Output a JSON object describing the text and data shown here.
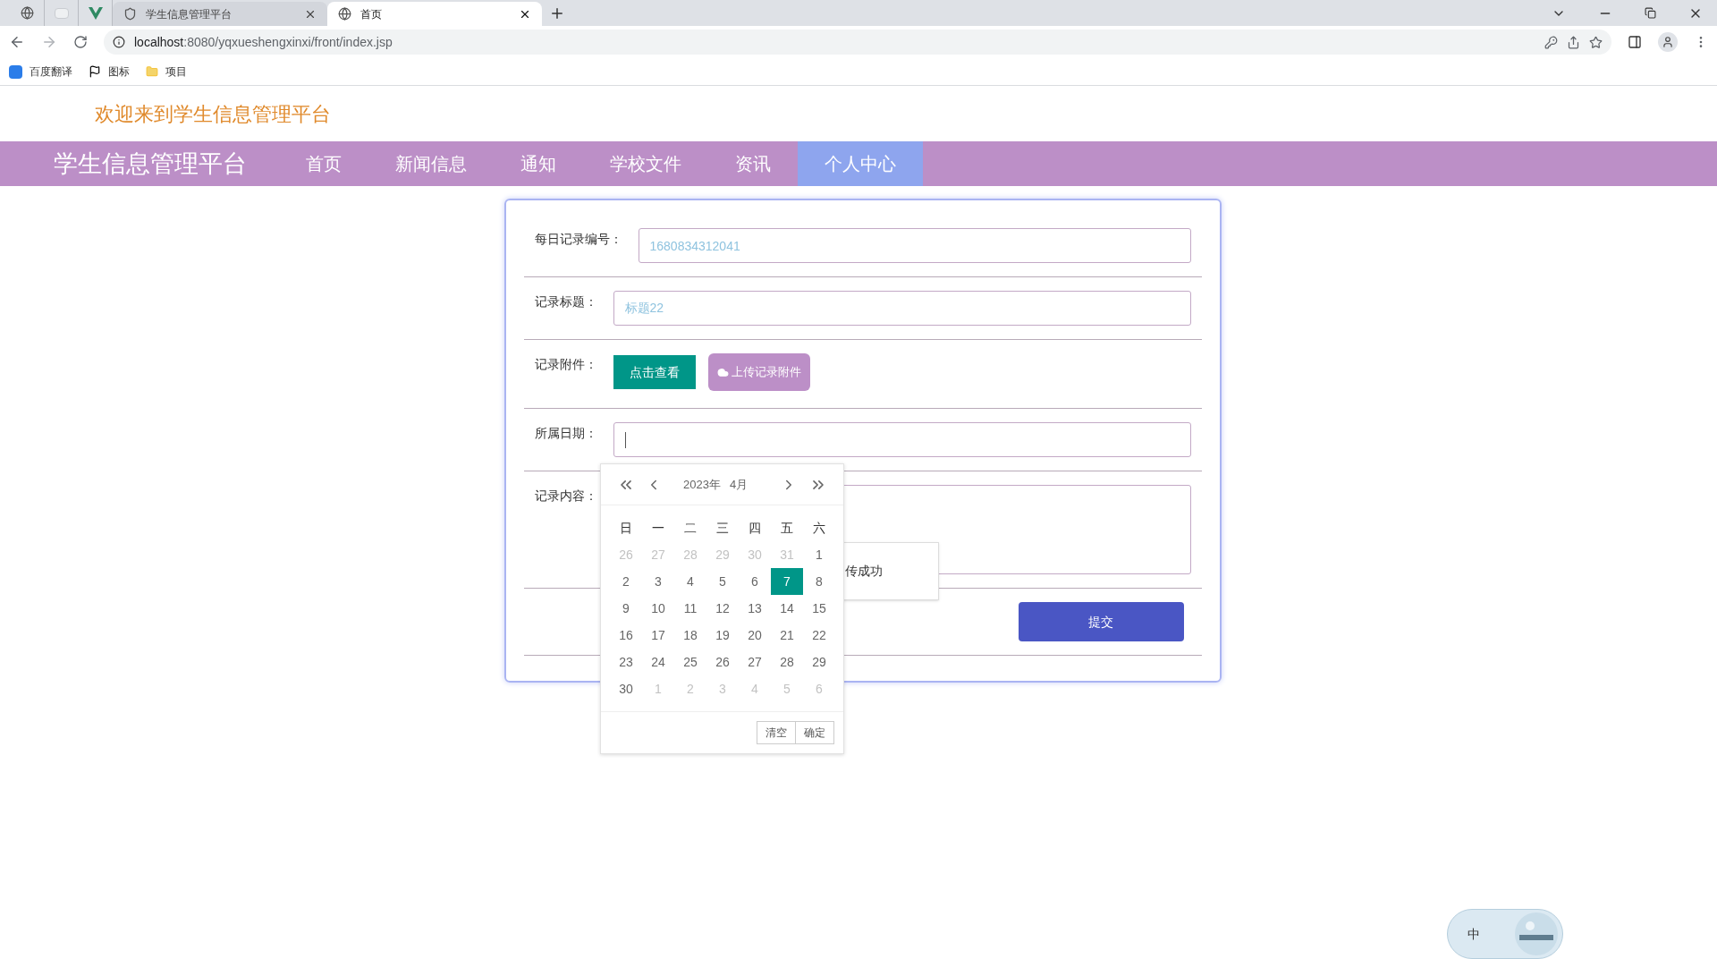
{
  "browser": {
    "tabs": [
      {
        "title": "学生信息管理平台",
        "selected": false
      },
      {
        "title": "首页",
        "selected": true
      }
    ],
    "url_host": "localhost",
    "url_rest": ":8080/yqxueshengxinxi/front/index.jsp",
    "bookmarks": [
      {
        "kind": "translate",
        "label": "百度翻译"
      },
      {
        "kind": "flag",
        "label": "图标"
      },
      {
        "kind": "folder",
        "label": "项目"
      }
    ]
  },
  "header": {
    "welcome": "欢迎来到学生信息管理平台"
  },
  "nav": {
    "brand": "学生信息管理平台",
    "items": [
      {
        "label": "首页",
        "selected": false
      },
      {
        "label": "新闻信息",
        "selected": false
      },
      {
        "label": "通知",
        "selected": false
      },
      {
        "label": "学校文件",
        "selected": false
      },
      {
        "label": "资讯",
        "selected": false
      },
      {
        "label": "个人中心",
        "selected": true
      }
    ]
  },
  "form": {
    "fields": [
      {
        "kind": "input",
        "label": "每日记录编号：",
        "value": "1680834312041"
      },
      {
        "kind": "input",
        "label": "记录标题：",
        "value": "标题22"
      },
      {
        "kind": "attachment",
        "label": "记录附件：",
        "view_button": "点击查看",
        "upload_button": "上传记录附件"
      },
      {
        "kind": "date",
        "label": "所属日期："
      },
      {
        "kind": "textarea",
        "label": "记录内容："
      }
    ],
    "submit": "提交"
  },
  "toast": {
    "text": "传成功"
  },
  "calendar": {
    "year": "2023年",
    "month": "4月",
    "weekdays": [
      "日",
      "一",
      "二",
      "三",
      "四",
      "五",
      "六"
    ],
    "days": [
      {
        "label": "26",
        "muted": true,
        "selected": false
      },
      {
        "label": "27",
        "muted": true,
        "selected": false
      },
      {
        "label": "28",
        "muted": true,
        "selected": false
      },
      {
        "label": "29",
        "muted": true,
        "selected": false
      },
      {
        "label": "30",
        "muted": true,
        "selected": false
      },
      {
        "label": "31",
        "muted": true,
        "selected": false
      },
      {
        "label": "1",
        "muted": false,
        "selected": false
      },
      {
        "label": "2",
        "muted": false,
        "selected": false
      },
      {
        "label": "3",
        "muted": false,
        "selected": false
      },
      {
        "label": "4",
        "muted": false,
        "selected": false
      },
      {
        "label": "5",
        "muted": false,
        "selected": false
      },
      {
        "label": "6",
        "muted": false,
        "selected": false
      },
      {
        "label": "7",
        "muted": false,
        "selected": true
      },
      {
        "label": "8",
        "muted": false,
        "selected": false
      },
      {
        "label": "9",
        "muted": false,
        "selected": false
      },
      {
        "label": "10",
        "muted": false,
        "selected": false
      },
      {
        "label": "11",
        "muted": false,
        "selected": false
      },
      {
        "label": "12",
        "muted": false,
        "selected": false
      },
      {
        "label": "13",
        "muted": false,
        "selected": false
      },
      {
        "label": "14",
        "muted": false,
        "selected": false
      },
      {
        "label": "15",
        "muted": false,
        "selected": false
      },
      {
        "label": "16",
        "muted": false,
        "selected": false
      },
      {
        "label": "17",
        "muted": false,
        "selected": false
      },
      {
        "label": "18",
        "muted": false,
        "selected": false
      },
      {
        "label": "19",
        "muted": false,
        "selected": false
      },
      {
        "label": "20",
        "muted": false,
        "selected": false
      },
      {
        "label": "21",
        "muted": false,
        "selected": false
      },
      {
        "label": "22",
        "muted": false,
        "selected": false
      },
      {
        "label": "23",
        "muted": false,
        "selected": false
      },
      {
        "label": "24",
        "muted": false,
        "selected": false
      },
      {
        "label": "25",
        "muted": false,
        "selected": false
      },
      {
        "label": "26",
        "muted": false,
        "selected": false
      },
      {
        "label": "27",
        "muted": false,
        "selected": false
      },
      {
        "label": "28",
        "muted": false,
        "selected": false
      },
      {
        "label": "29",
        "muted": false,
        "selected": false
      },
      {
        "label": "30",
        "muted": false,
        "selected": false
      },
      {
        "label": "1",
        "muted": true,
        "selected": false
      },
      {
        "label": "2",
        "muted": true,
        "selected": false
      },
      {
        "label": "3",
        "muted": true,
        "selected": false
      },
      {
        "label": "4",
        "muted": true,
        "selected": false
      },
      {
        "label": "5",
        "muted": true,
        "selected": false
      },
      {
        "label": "6",
        "muted": true,
        "selected": false
      }
    ],
    "buttons": [
      "清空",
      "确定"
    ]
  },
  "ime": {
    "label": "中"
  }
}
